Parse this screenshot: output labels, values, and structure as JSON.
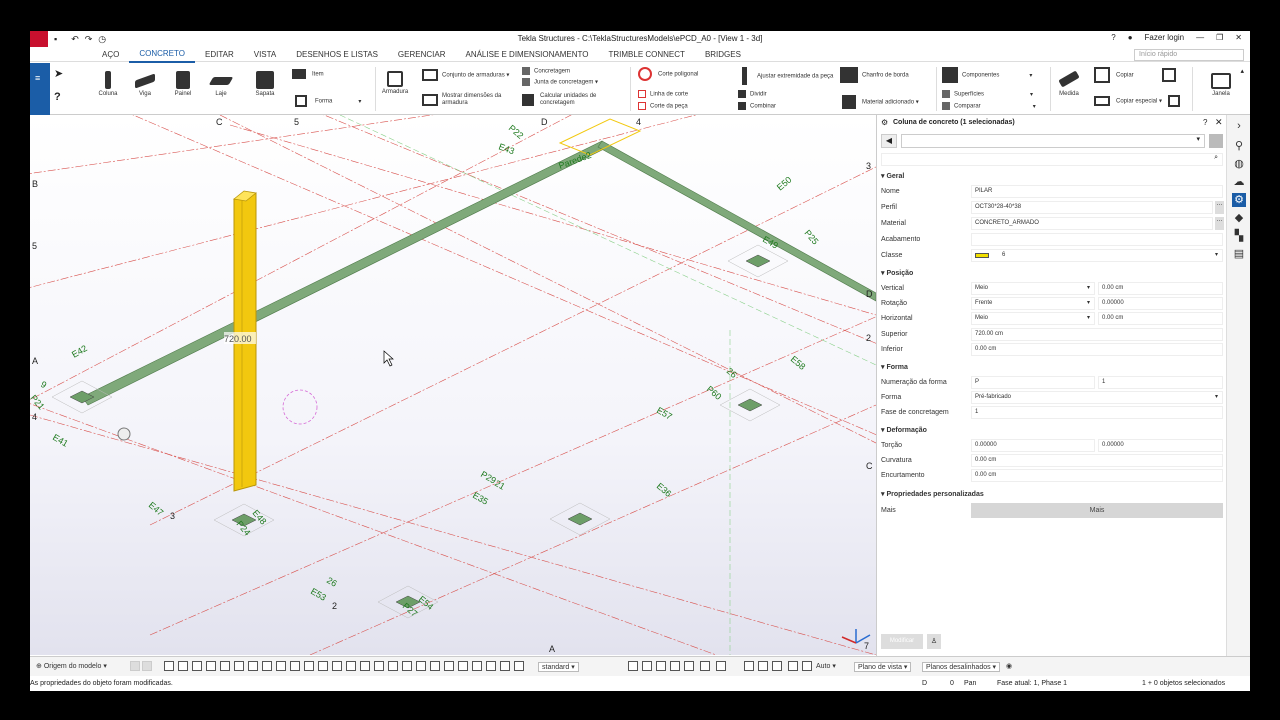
{
  "window": {
    "title": "Tekla Structures - C:\\TeklaStructuresModels\\ePCD_A0 - [View 1 - 3d]",
    "login": "Fazer login",
    "quick_search": "Início rápido"
  },
  "menu": [
    "AÇO",
    "CONCRETO",
    "EDITAR",
    "VISTA",
    "DESENHOS E LISTAS",
    "GERENCIAR",
    "ANÁLISE E DIMENSIONAMENTO",
    "TRIMBLE CONNECT",
    "BRIDGES"
  ],
  "ribbon": {
    "coluna": "Coluna",
    "viga": "Viga",
    "painel": "Painel",
    "laje": "Laje",
    "sapata": "Sapata",
    "item": "Item",
    "forma": "Forma",
    "armadura": "Armadura",
    "conjunto": "Conjunto de armaduras",
    "mostrar": "Mostrar dimensões da armadura",
    "concretagem": "Concretagem",
    "junta": "Junta de concretagem",
    "calcular": "Calcular unidades de concretagem",
    "corte_poligonal": "Corte poligonal",
    "linha_corte": "Linha de corte",
    "corte_peca": "Corte da peça",
    "ajustar": "Ajustar extremidade da peça",
    "dividir": "Dividir",
    "combinar": "Combinar",
    "chanfro": "Chanfro de borda",
    "material_adicionado": "Material adicionado",
    "componentes": "Componentes",
    "superficies": "Superfícies",
    "comparar": "Comparar",
    "medida": "Medida",
    "copiar": "Copiar",
    "copiar_especial": "Copiar especial",
    "janela": "Janela"
  },
  "viewport": {
    "column_label": "720.00",
    "grid_labels": [
      "C",
      "5",
      "D",
      "4",
      "3",
      "B",
      "5",
      "A",
      "4",
      "3",
      "2",
      "D",
      "2",
      "C",
      "A",
      "7"
    ],
    "element_labels": [
      "P22",
      "E43",
      "Parede2",
      "E50",
      "P25",
      "E49",
      "E42",
      "E41",
      "9",
      "P21",
      "26",
      "E58",
      "P60",
      "E57",
      "P29",
      "21",
      "E35",
      "E36",
      "E47",
      "E48",
      "P24",
      "26",
      "E53",
      "E54",
      "P27"
    ]
  },
  "panel": {
    "header": "Coluna de concreto (1 selecionadas)",
    "sections": {
      "geral": "Geral",
      "posicao": "Posição",
      "forma": "Forma",
      "deformacao": "Deformação",
      "personalizadas": "Propriedades personalizadas"
    },
    "rows": {
      "nome": {
        "label": "Nome",
        "value": "PILAR"
      },
      "perfil": {
        "label": "Perfil",
        "value": "OCT30*28-40*38"
      },
      "material": {
        "label": "Material",
        "value": "CONCRETO_ARMADO"
      },
      "acabamento": {
        "label": "Acabamento",
        "value": ""
      },
      "classe": {
        "label": "Classe",
        "value": "6"
      },
      "vertical": {
        "label": "Vertical",
        "value": "Meio",
        "value2": "0.00 cm"
      },
      "rotacao": {
        "label": "Rotação",
        "value": "Frente",
        "value2": "0.00000"
      },
      "horizontal": {
        "label": "Horizontal",
        "value": "Meio",
        "value2": "0.00 cm"
      },
      "superior": {
        "label": "Superior",
        "value": "720.00 cm"
      },
      "inferior": {
        "label": "Inferior",
        "value": "0.00 cm"
      },
      "numeracao": {
        "label": "Numeração da forma",
        "value": "P",
        "value2": "1"
      },
      "forma": {
        "label": "Forma",
        "value": "Pré-fabricado"
      },
      "fase": {
        "label": "Fase de concretagem",
        "value": "1"
      },
      "torcao": {
        "label": "Torção",
        "value": "0.00000",
        "value2": "0.00000"
      },
      "curvatura": {
        "label": "Curvatura",
        "value": "0.00 cm"
      },
      "encurtamento": {
        "label": "Encurtamento",
        "value": "0.00 cm"
      },
      "mais": {
        "label": "Mais",
        "value": "Mais"
      }
    },
    "modify": "Modificar"
  },
  "bottombar": {
    "origin": "Origem do modelo",
    "standard": "standard",
    "auto": "Auto",
    "plano": "Plano de vista",
    "planos": "Planos desalinhados"
  },
  "status": {
    "message": "As propriedades do objeto foram modificadas.",
    "d": "D",
    "zero": "0",
    "pan": "Pan",
    "fase": "Fase atual: 1, Phase 1",
    "selected": "1 + 0 objetos selecionados"
  },
  "colors": {
    "accent": "#1b5da7",
    "column": "#f2c80f",
    "beam": "#7fa97a",
    "grid": "#d9534f",
    "label": "#1e7a1e"
  }
}
